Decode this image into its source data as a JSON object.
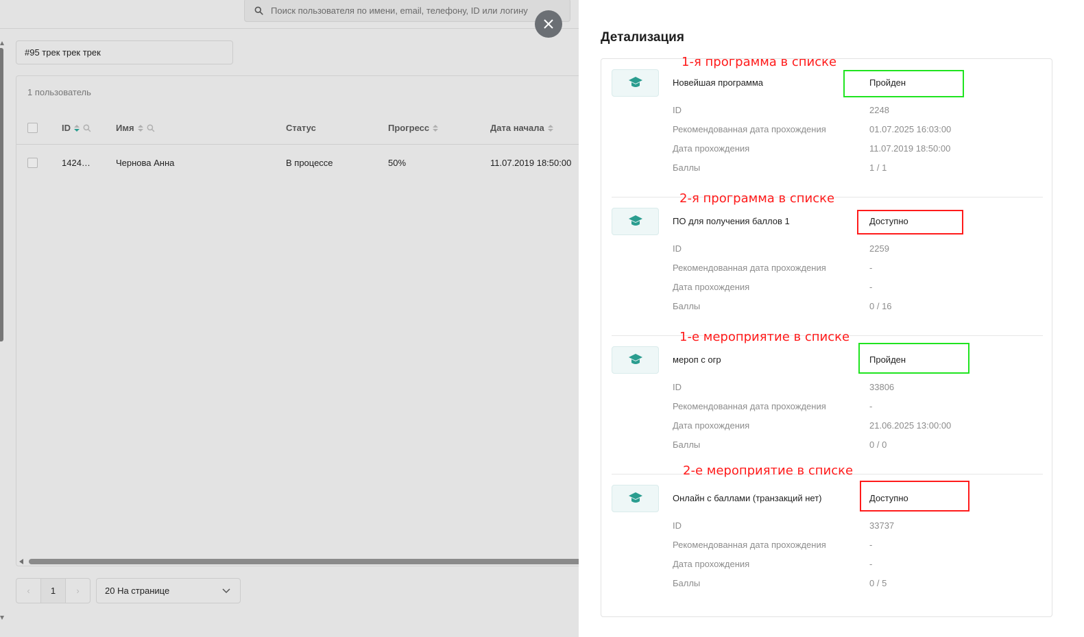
{
  "search": {
    "placeholder": "Поиск пользователя по имени, email, телефону, ID или логину"
  },
  "track": {
    "label": "#95 трек трек трек"
  },
  "table": {
    "count_label": "1 пользователь",
    "columns": [
      "ID",
      "Имя",
      "Статус",
      "Прогресс",
      "Дата начала"
    ],
    "rows": [
      {
        "id": "1424…",
        "name": "Чернова Анна",
        "status": "В процессе",
        "progress": "50%",
        "start": "11.07.2019 18:50:00"
      }
    ]
  },
  "pagination": {
    "prev": "‹",
    "page": "1",
    "next": "›",
    "per_page": "20 На странице"
  },
  "icons": {
    "close": "close-icon",
    "search": "search-icon",
    "program": "graduation-cap-icon"
  },
  "colors": {
    "accent": "#2a9d8f",
    "annotation_red": "#ff1a1a",
    "annotation_green": "#1fe41f"
  },
  "panel": {
    "title": "Детализация",
    "field_labels": {
      "id": "ID",
      "recommended": "Рекомендованная дата прохождения",
      "completed": "Дата прохождения",
      "score": "Баллы"
    },
    "programs": [
      {
        "name": "Новейшая программа",
        "status": "Пройден",
        "id": "2248",
        "recommended": "01.07.2025 16:03:00",
        "completed": "11.07.2019 18:50:00",
        "score": "1 / 1",
        "annotation": "1-я программа в списке",
        "box": "green"
      },
      {
        "name": "ПО для получения баллов 1",
        "status": "Доступно",
        "id": "2259",
        "recommended": "-",
        "completed": "-",
        "score": "0 / 16",
        "annotation": "2-я программа в списке",
        "box": "red"
      },
      {
        "name": "мероп с огр",
        "status": "Пройден",
        "id": "33806",
        "recommended": "-",
        "completed": "21.06.2025 13:00:00",
        "score": "0 / 0",
        "annotation": "1-е мероприятие в списке",
        "box": "green"
      },
      {
        "name": "Онлайн с баллами (транзакций нет)",
        "status": "Доступно",
        "id": "33737",
        "recommended": "-",
        "completed": "-",
        "score": "0 / 5",
        "annotation": "2-е мероприятие в списке",
        "box": "red"
      }
    ]
  }
}
